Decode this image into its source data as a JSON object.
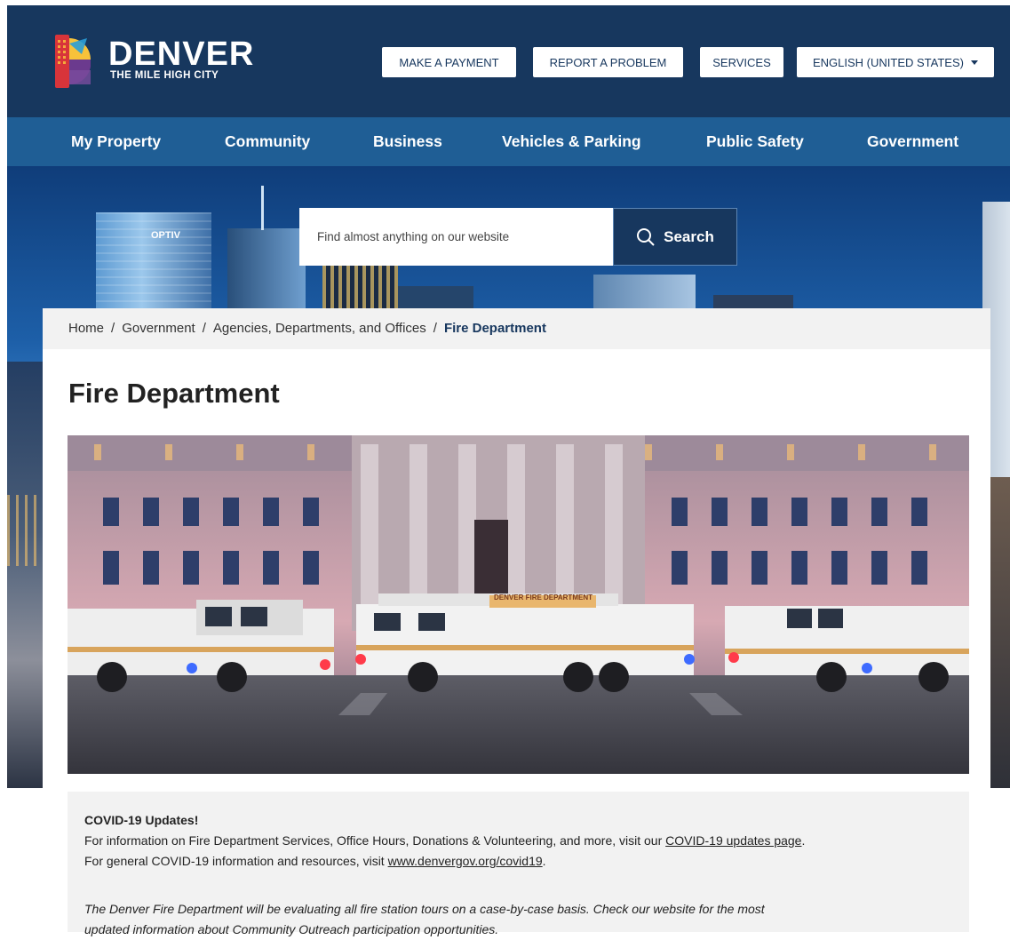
{
  "header": {
    "logo_name": "DENVER",
    "logo_tagline": "THE MILE HIGH CITY",
    "buttons": {
      "payment": "MAKE A PAYMENT",
      "report": "REPORT A PROBLEM",
      "services": "SERVICES",
      "language": "ENGLISH (UNITED STATES)"
    }
  },
  "nav": {
    "items": [
      "My Property",
      "Community",
      "Business",
      "Vehicles & Parking",
      "Public Safety",
      "Government"
    ]
  },
  "hero": {
    "building_sign": "OPTIV"
  },
  "search": {
    "placeholder": "Find almost anything on our website",
    "button_label": "Search"
  },
  "breadcrumb": {
    "items": [
      "Home",
      "Government",
      "Agencies, Departments, and Offices",
      "Fire Department"
    ],
    "separator": "/"
  },
  "page": {
    "title": "Fire Department"
  },
  "photo": {
    "truck_sign": "DENVER FIRE DEPARTMENT"
  },
  "notice": {
    "heading": "COVID-19 Updates!",
    "line1_text": "For information on Fire Department Services, Office Hours, Donations & Volunteering, and more, visit our ",
    "line1_link": "COVID-19 updates page",
    "line1_end": ".",
    "line2_text": "For general COVID-19 information and resources, visit ",
    "line2_link": "www.denvergov.org/covid19",
    "line2_end": ".",
    "italic_line1": "The Denver Fire Department will be evaluating all fire station tours on a case-by-case basis. Check our website for the most",
    "italic_line2": "updated information about Community Outreach participation opportunities."
  },
  "colors": {
    "header_bg": "#17375e",
    "nav_bg": "#1f5e95",
    "notice_bg": "#f2f2f2",
    "breadcrumb_bg": "#f2f2f2"
  }
}
